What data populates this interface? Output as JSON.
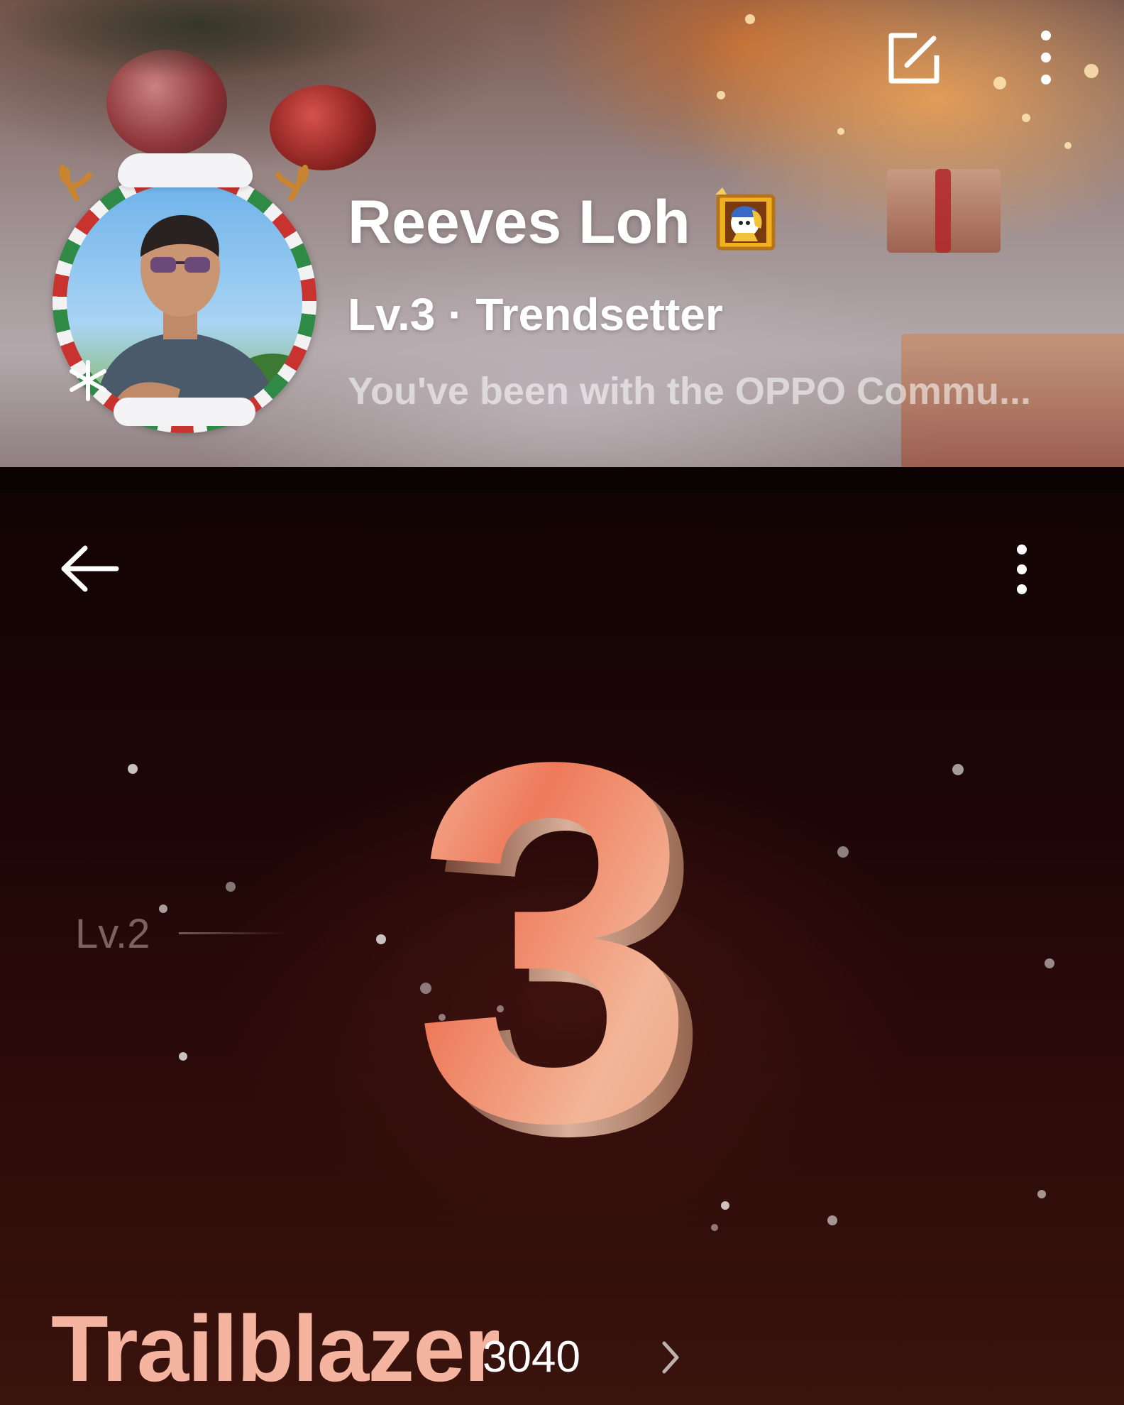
{
  "profile": {
    "username": "Reeves Loh",
    "level_title": "Lv.3 · Trendsetter",
    "bio": "You've been with the OPPO Commu...",
    "avatar": "user-avatar-photo",
    "badge_icon": "pearl-earring-girl-badge-icon"
  },
  "top_bar": {
    "icons": [
      "edit-icon",
      "more-vertical-icon"
    ]
  },
  "level_page": {
    "nav_icons": [
      "back-arrow-icon",
      "more-vertical-icon"
    ],
    "current_level": "3",
    "previous_level_label": "Lv.2",
    "rank_title": "Trailblazer",
    "points": "3040",
    "accent_color": "#f5b49f"
  }
}
